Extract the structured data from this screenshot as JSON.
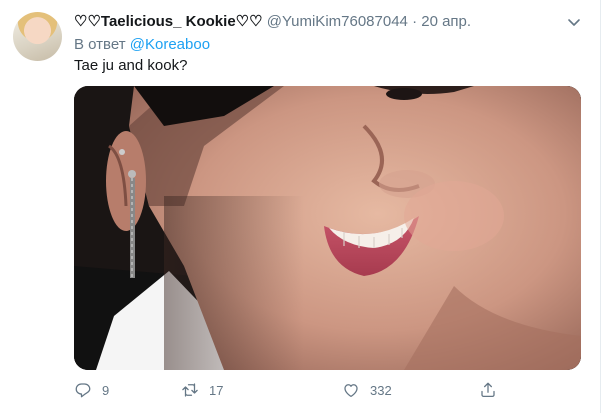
{
  "tweet": {
    "author_name": "♡♡Taelicious_ Kookie♡♡",
    "handle": "@YumiKim76087044",
    "separator": "·",
    "date": "20 апр.",
    "reply_prefix": "В ответ",
    "reply_to": "@Koreaboo",
    "text": "Tae ju and kook?"
  },
  "actions": {
    "reply_count": "9",
    "retweet_count": "17",
    "like_count": "332"
  },
  "colors": {
    "accent": "#1da1f2",
    "secondary_text": "#657786",
    "primary_text": "#14171a"
  },
  "icons": [
    "chevron-down-icon",
    "reply-icon",
    "retweet-icon",
    "like-icon",
    "share-icon"
  ]
}
